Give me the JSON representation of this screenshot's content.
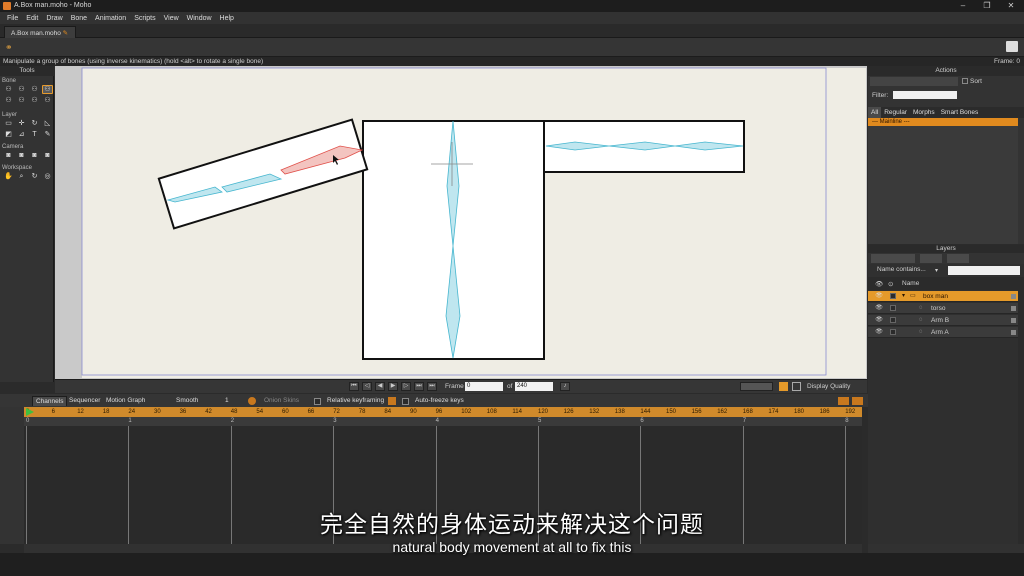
{
  "window": {
    "title": "A.Box man.moho - Moho",
    "controls": [
      "–",
      "❐",
      "✕"
    ]
  },
  "menu": [
    "File",
    "Edit",
    "Draw",
    "Bone",
    "Animation",
    "Scripts",
    "View",
    "Window",
    "Help"
  ],
  "document_tab": "A.Box man.moho",
  "status_message": "Manipulate a group of bones (using inverse kinematics) (hold <alt> to rotate a single bone)",
  "frame_indicator": "Frame: 0",
  "tools": {
    "title": "Tools",
    "sections": {
      "bone": "Bone",
      "layer": "Layer",
      "camera": "Camera",
      "workspace": "Workspace"
    }
  },
  "playback": {
    "frame_label": "Frame",
    "frame_value": "0",
    "of_label": "of",
    "total_frames": "240",
    "display_quality": "Display Quality"
  },
  "timeline": {
    "tabs": [
      "Channels",
      "Sequencer",
      "Motion Graph"
    ],
    "interpolation": "Smooth",
    "step": "1",
    "onion_skins": "Onion Skins",
    "relative_keyframing": "Relative keyframing",
    "auto_freeze": "Auto-freeze keys",
    "ruler_frames": [
      "0",
      "6",
      "12",
      "18",
      "24",
      "30",
      "36",
      "42",
      "48",
      "54",
      "60",
      "66",
      "72",
      "78",
      "84",
      "90",
      "96",
      "102",
      "108",
      "114",
      "120",
      "126",
      "132",
      "138",
      "144",
      "150",
      "156",
      "162",
      "168",
      "174",
      "180",
      "186",
      "192"
    ],
    "seconds": [
      "0",
      "1",
      "2",
      "3",
      "4",
      "5",
      "6",
      "7",
      "8"
    ]
  },
  "actions": {
    "title": "Actions",
    "sort": "Sort",
    "filter_label": "Filter:",
    "tabs": [
      "All",
      "Regular",
      "Morphs",
      "Smart Bones"
    ],
    "mainline": "--- Mainline ---"
  },
  "layers": {
    "title": "Layers",
    "filter_mode": "Name contains...",
    "name_header": "Name",
    "rows": [
      {
        "name": "box man",
        "selected": true,
        "indent": 0
      },
      {
        "name": "torso",
        "selected": false,
        "indent": 1
      },
      {
        "name": "Arm B",
        "selected": false,
        "indent": 1
      },
      {
        "name": "Arm A",
        "selected": false,
        "indent": 1
      }
    ]
  },
  "subtitles": {
    "zh": "完全自然的身体运动来解决这个问题",
    "en": "natural body movement at all to fix this"
  },
  "colors": {
    "accent": "#e59a2a",
    "bone": "#46b6cf",
    "bone_selected": "#e0504a"
  }
}
